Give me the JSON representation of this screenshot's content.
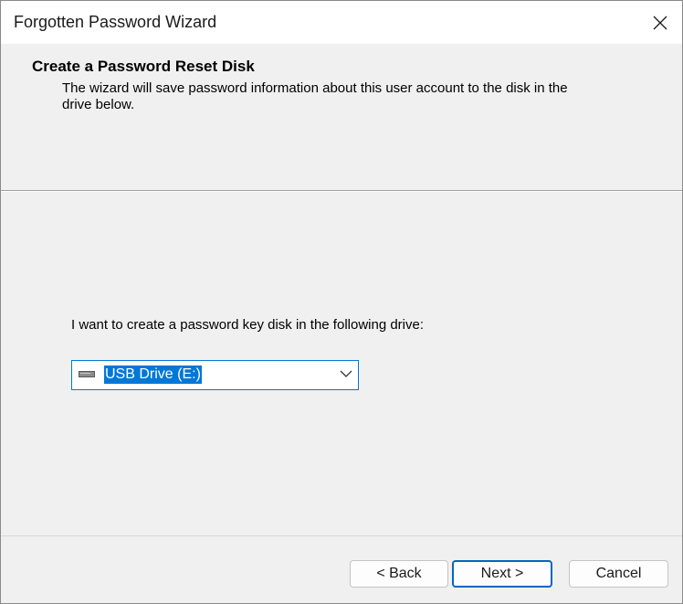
{
  "window": {
    "title": "Forgotten Password Wizard"
  },
  "titlebar": {
    "close_icon": "close-icon"
  },
  "header": {
    "title": "Create a Password Reset Disk",
    "description": "The wizard will save password information about this user account to the disk in the drive below."
  },
  "body": {
    "drive_label": "I want to create a password key disk in the following drive:",
    "drive_select": {
      "selected_value": "USB Drive (E:)",
      "icon": "usb-drive-icon",
      "dropdown_icon": "chevron-down-icon"
    }
  },
  "buttons": {
    "back_label": "< Back",
    "next_label": "Next >",
    "cancel_label": "Cancel"
  },
  "colors": {
    "accent": "#0078d4",
    "selection": "#0078d7",
    "dialog_background": "#f0f0f0"
  }
}
